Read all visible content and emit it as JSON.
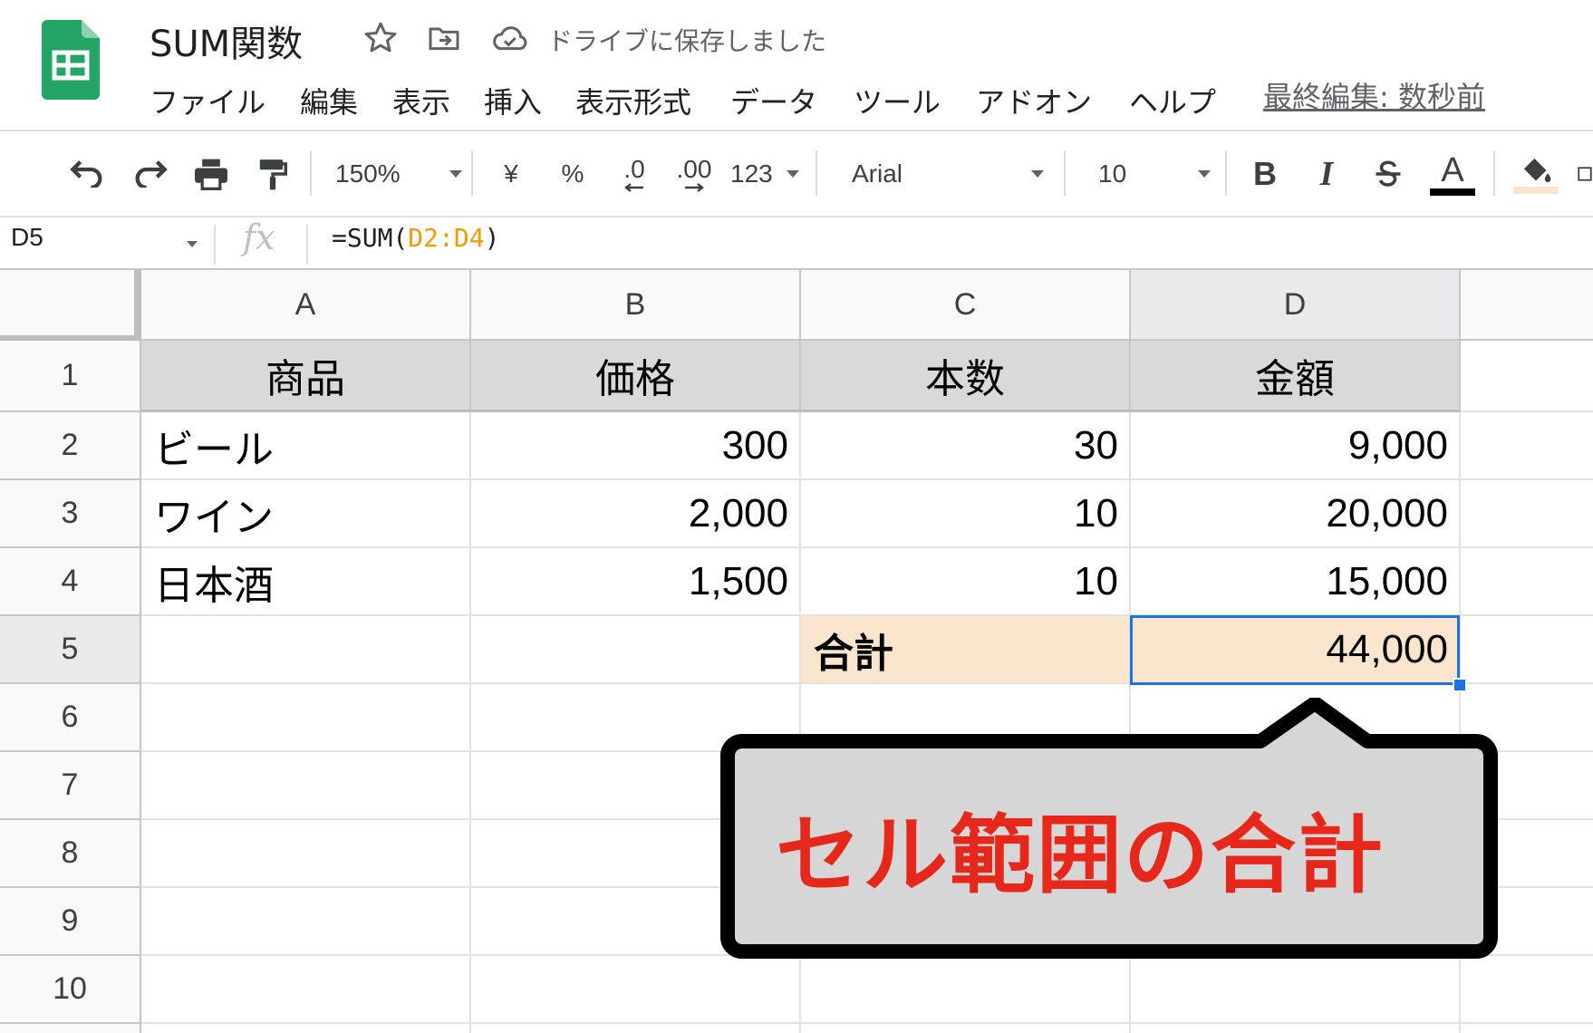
{
  "app": {
    "accent": "#1a73e8",
    "brand_green": "#23a566"
  },
  "header": {
    "doc_title": "SUM関数",
    "icons": [
      "star-icon",
      "move-to-folder-icon",
      "cloud-saved-icon"
    ],
    "save_status": "ドライブに保存しました",
    "last_edit": "最終編集: 数秒前"
  },
  "menu": [
    "ファイル",
    "編集",
    "表示",
    "挿入",
    "表示形式",
    "データ",
    "ツール",
    "アドオン",
    "ヘルプ"
  ],
  "toolbar": {
    "zoom": "150%",
    "currency": "¥",
    "percent": "%",
    "decimal_decrease": ".0",
    "decimal_increase": ".00",
    "more_formats": "123",
    "font": "Arial",
    "font_size": "10",
    "bold": "B",
    "italic": "I",
    "text_color_letter": "A"
  },
  "formula_bar": {
    "cell_ref": "D5",
    "fx": "fx",
    "formula_prefix": "=SUM(",
    "formula_range": "D2:D4",
    "formula_suffix": ")"
  },
  "sheet": {
    "columns": [
      "A",
      "B",
      "C",
      "D"
    ],
    "rows": [
      "1",
      "2",
      "3",
      "4",
      "5",
      "6",
      "7",
      "8",
      "9",
      "10"
    ],
    "headers": [
      "商品",
      "価格",
      "本数",
      "金額"
    ],
    "data": [
      [
        "ビール",
        "300",
        "30",
        "9,000"
      ],
      [
        "ワイン",
        "2,000",
        "10",
        "20,000"
      ],
      [
        "日本酒",
        "1,500",
        "10",
        "15,000"
      ]
    ],
    "total_label": "合計",
    "total_value": "44,000",
    "selected_cell": "D5"
  },
  "callout": {
    "text": "セル範囲の合計",
    "text_color": "#e8271b"
  }
}
